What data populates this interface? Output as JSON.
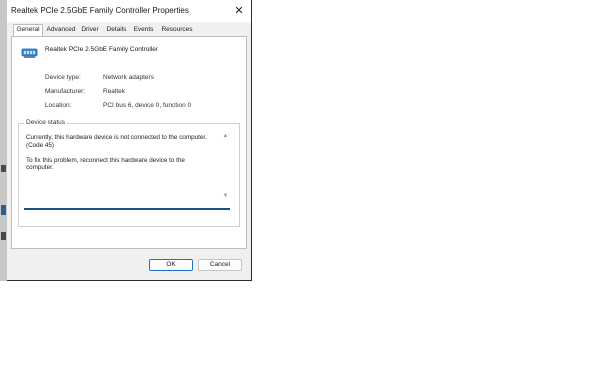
{
  "dialog": {
    "title": "Realtek PCIe 2.5GbE Family Controller Properties",
    "close_glyph": "✕"
  },
  "tabs": [
    {
      "label": "General",
      "active": true
    },
    {
      "label": "Advanced",
      "active": false
    },
    {
      "label": "Driver",
      "active": false
    },
    {
      "label": "Details",
      "active": false
    },
    {
      "label": "Events",
      "active": false
    },
    {
      "label": "Resources",
      "active": false
    }
  ],
  "general": {
    "device_name": "Realtek PCIe 2.5GbE Family Controller",
    "device_icon": "network-adapter-icon",
    "properties": [
      {
        "label": "Device type:",
        "value": "Network adapters"
      },
      {
        "label": "Manufacturer:",
        "value": "Realtek"
      },
      {
        "label": "Location:",
        "value": "PCI bus 6, device 0, function 0"
      }
    ],
    "status_legend": "Device status",
    "status_text": "Currently, this hardware device is not connected to the computer. (Code 45)\n\nTo fix this problem, reconnect this hardware device to the computer."
  },
  "buttons": {
    "ok": "OK",
    "cancel": "Cancel"
  },
  "colors": {
    "accent": "#1f6fd1",
    "focus_underline": "#1f4f82"
  }
}
